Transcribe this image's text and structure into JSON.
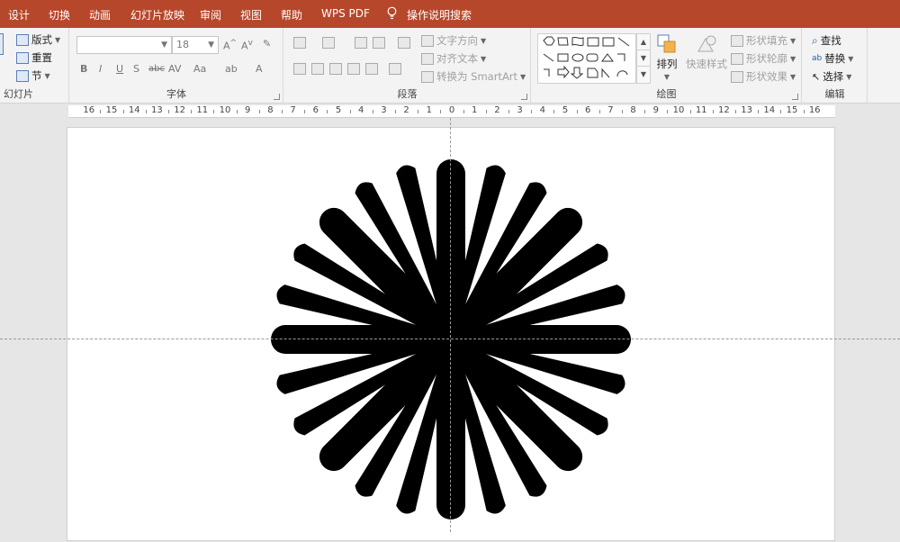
{
  "tabs": [
    "设计",
    "切换",
    "动画",
    "幻灯片放映",
    "审阅",
    "视图",
    "帮助",
    "WPS PDF",
    "操作说明搜索"
  ],
  "slides_group": {
    "label": "幻灯片",
    "layout": "版式",
    "reset": "重置",
    "section": "节"
  },
  "font_group": {
    "label": "字体",
    "font_name": "",
    "font_size": "18",
    "buttons": [
      "B",
      "I",
      "U",
      "S",
      "abc",
      "AV",
      "Aa",
      "ab",
      "A"
    ]
  },
  "paragraph_group": {
    "label": "段落",
    "text_direction": "文字方向",
    "align_text": "对齐文本",
    "convert_smartart": "转换为 SmartArt"
  },
  "drawing_group": {
    "label": "绘图",
    "arrange": "排列",
    "quick_styles": "快速样式",
    "shape_fill": "形状填充",
    "shape_outline": "形状轮廓",
    "shape_effects": "形状效果"
  },
  "editing_group": {
    "label": "编辑",
    "find": "查找",
    "replace": "替换",
    "select": "选择"
  },
  "ruler_numbers": [
    "16",
    "15",
    "14",
    "13",
    "12",
    "11",
    "10",
    "9",
    "8",
    "7",
    "6",
    "5",
    "4",
    "3",
    "2",
    "1",
    "0",
    "1",
    "2",
    "3",
    "4",
    "5",
    "6",
    "7",
    "8",
    "9",
    "10",
    "11",
    "12",
    "13",
    "14",
    "15",
    "16"
  ],
  "colors": {
    "tabbar": "#b7472a",
    "ribbon": "#f3f3f3",
    "shape_fill": "#000000"
  }
}
